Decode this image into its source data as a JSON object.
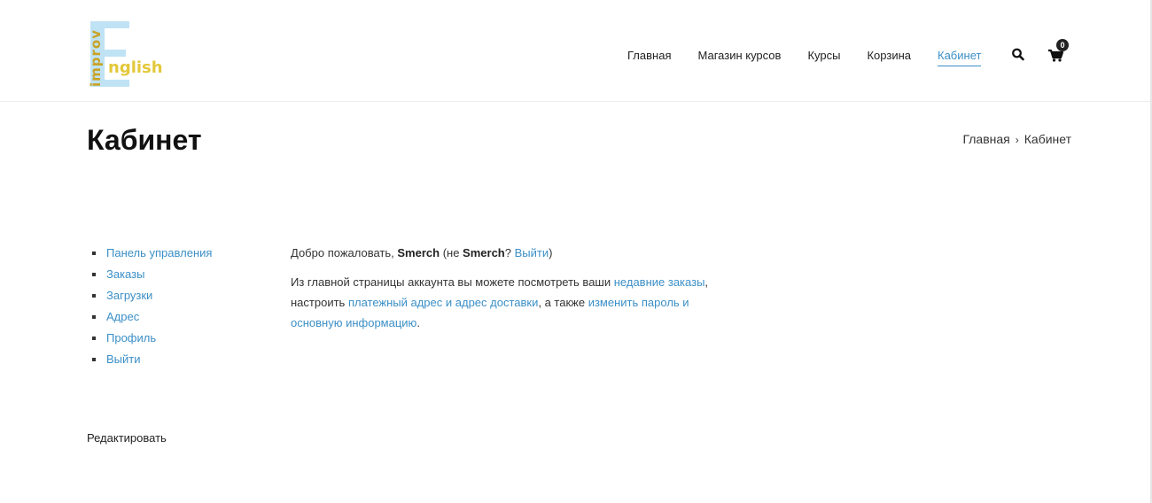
{
  "logo": {
    "vertical_text": "improv",
    "word_text": "nglish",
    "colors": {
      "letter_e": "#bfe3f5",
      "vertical": "#c9a227",
      "word": "#e3c83a"
    }
  },
  "nav": {
    "items": [
      {
        "label": "Главная",
        "active": false
      },
      {
        "label": "Магазин курсов",
        "active": false
      },
      {
        "label": "Курсы",
        "active": false
      },
      {
        "label": "Корзина",
        "active": false
      },
      {
        "label": "Кабинет",
        "active": true
      }
    ],
    "search_icon": "search-icon",
    "cart_icon": "shopping-cart-icon",
    "cart_count": "0"
  },
  "page": {
    "title": "Кабинет",
    "breadcrumb": {
      "home": "Главная",
      "separator": "›",
      "current": "Кабинет"
    }
  },
  "account_nav": {
    "items": [
      {
        "label": "Панель управления"
      },
      {
        "label": "Заказы"
      },
      {
        "label": "Загрузки"
      },
      {
        "label": "Адрес"
      },
      {
        "label": "Профиль"
      },
      {
        "label": "Выйти"
      }
    ]
  },
  "content": {
    "welcome_prefix": "Добро пожаловать, ",
    "username": "Smerch",
    "welcome_mid": " (не ",
    "username_again": "Smerch",
    "welcome_q": "? ",
    "logout_link": "Выйти",
    "welcome_end": ")",
    "para_1": "Из главной страницы аккаунта вы можете посмотреть ваши ",
    "link_recent_orders": "недавние заказы",
    "para_2": ", настроить ",
    "link_addresses": "платежный адрес и адрес доставки",
    "para_3": ", а также ",
    "link_password": "изменить пароль и основную информацию",
    "para_4": "."
  },
  "edit_label": "Редактировать",
  "colors": {
    "accent": "#3b8fc7",
    "text": "#333333",
    "heading": "#111111"
  }
}
